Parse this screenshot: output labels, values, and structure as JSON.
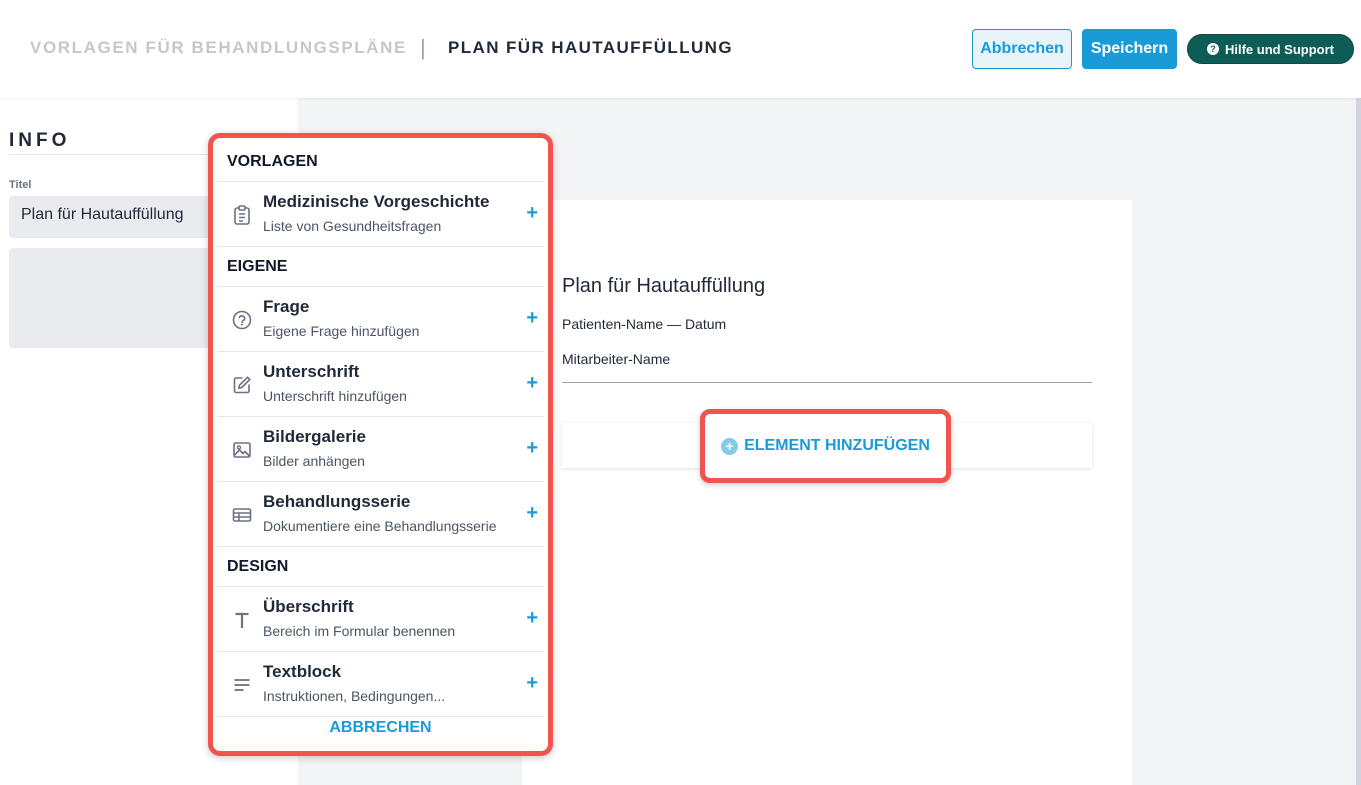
{
  "header": {
    "breadcrumb_parent": "VORLAGEN FÜR BEHANDLUNGSPLÄNE",
    "separator": "|",
    "breadcrumb_current": "PLAN FÜR HAUTAUFFÜLLUNG",
    "cancel_label": "Abbrechen",
    "save_label": "Speichern",
    "help_label": "Hilfe und Support"
  },
  "sidebar": {
    "section_title": "INFO",
    "title_label": "Titel",
    "title_value": "Plan für Hautauffüllung"
  },
  "document": {
    "title": "Plan für Hautauffüllung",
    "patient_line": "Patienten-Name — Datum",
    "staff_line": "Mitarbeiter-Name",
    "add_element_label": "ELEMENT HINZUFÜGEN"
  },
  "menu": {
    "sections": [
      {
        "label": "VORLAGEN",
        "items": [
          {
            "title": "Medizinische Vorgeschichte",
            "subtitle": "Liste von Gesundheitsfragen",
            "icon": "clipboard-icon"
          }
        ]
      },
      {
        "label": "EIGENE",
        "items": [
          {
            "title": "Frage",
            "subtitle": "Eigene Frage hinzufügen",
            "icon": "question-circle-icon"
          },
          {
            "title": "Unterschrift",
            "subtitle": "Unterschrift hinzufügen",
            "icon": "pencil-square-icon"
          },
          {
            "title": "Bildergalerie",
            "subtitle": "Bilder anhängen",
            "icon": "image-icon"
          },
          {
            "title": "Behandlungsserie",
            "subtitle": "Dokumentiere eine Behandlungsserie",
            "icon": "table-icon"
          }
        ]
      },
      {
        "label": "DESIGN",
        "items": [
          {
            "title": "Überschrift",
            "subtitle": "Bereich im Formular benennen",
            "icon": "text-t-icon"
          },
          {
            "title": "Textblock",
            "subtitle": "Instruktionen, Bedingungen...",
            "icon": "text-lines-icon"
          }
        ]
      }
    ],
    "plus": "+",
    "cancel_label": "ABBRECHEN"
  },
  "colors": {
    "accent": "#1a9bd7",
    "help_button": "#0d5c55",
    "highlight": "#f0544f"
  }
}
